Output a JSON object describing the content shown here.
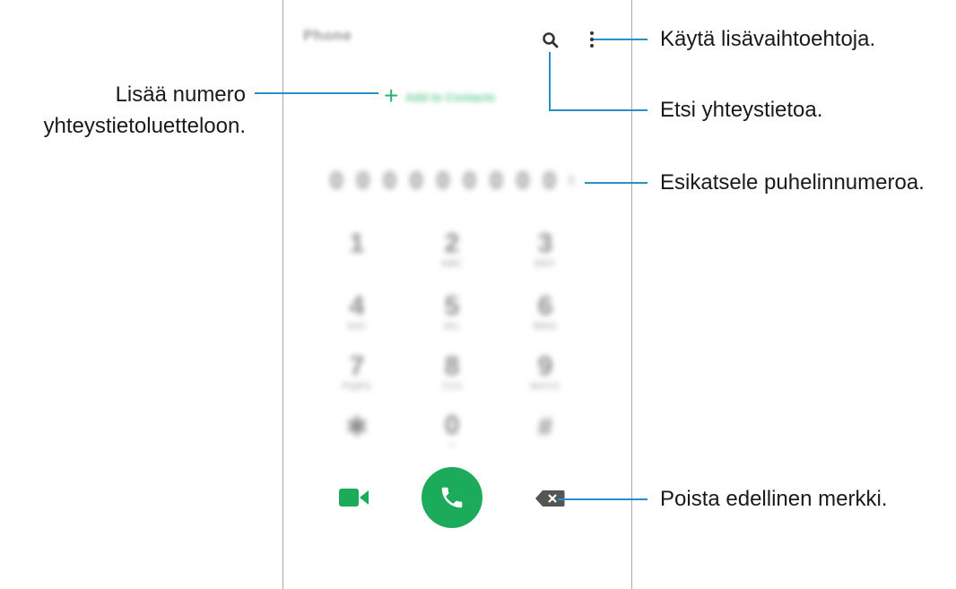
{
  "app": {
    "title": "Phone",
    "add_contact_label": "Add to Contacts",
    "number_preview": "0 0 0 0 0 0 0 0 0 0 0"
  },
  "keypad": [
    {
      "digit": "1",
      "letters": ""
    },
    {
      "digit": "2",
      "letters": "ABC"
    },
    {
      "digit": "3",
      "letters": "DEF"
    },
    {
      "digit": "4",
      "letters": "GHI"
    },
    {
      "digit": "5",
      "letters": "JKL"
    },
    {
      "digit": "6",
      "letters": "MNO"
    },
    {
      "digit": "7",
      "letters": "PQRS"
    },
    {
      "digit": "8",
      "letters": "TUV"
    },
    {
      "digit": "9",
      "letters": "WXYZ"
    },
    {
      "digit": "✱",
      "letters": ""
    },
    {
      "digit": "0",
      "letters": "+"
    },
    {
      "digit": "#",
      "letters": ""
    }
  ],
  "icons": {
    "search": "search-icon",
    "more": "more-options-icon",
    "add": "plus-icon",
    "video": "video-call-icon",
    "call": "phone-icon",
    "backspace": "backspace-icon"
  },
  "colors": {
    "accent": "#1cab5a",
    "leader_line": "#2a8fc8"
  },
  "callouts": {
    "more_options": "Käytä lisävaihtoehtoja.",
    "search": "Etsi yhteystietoa.",
    "preview": "Esikatsele puhelinnumeroa.",
    "delete": "Poista edellinen merkki.",
    "add_line1": "Lisää numero",
    "add_line2": "yhteystietoluetteloon."
  }
}
